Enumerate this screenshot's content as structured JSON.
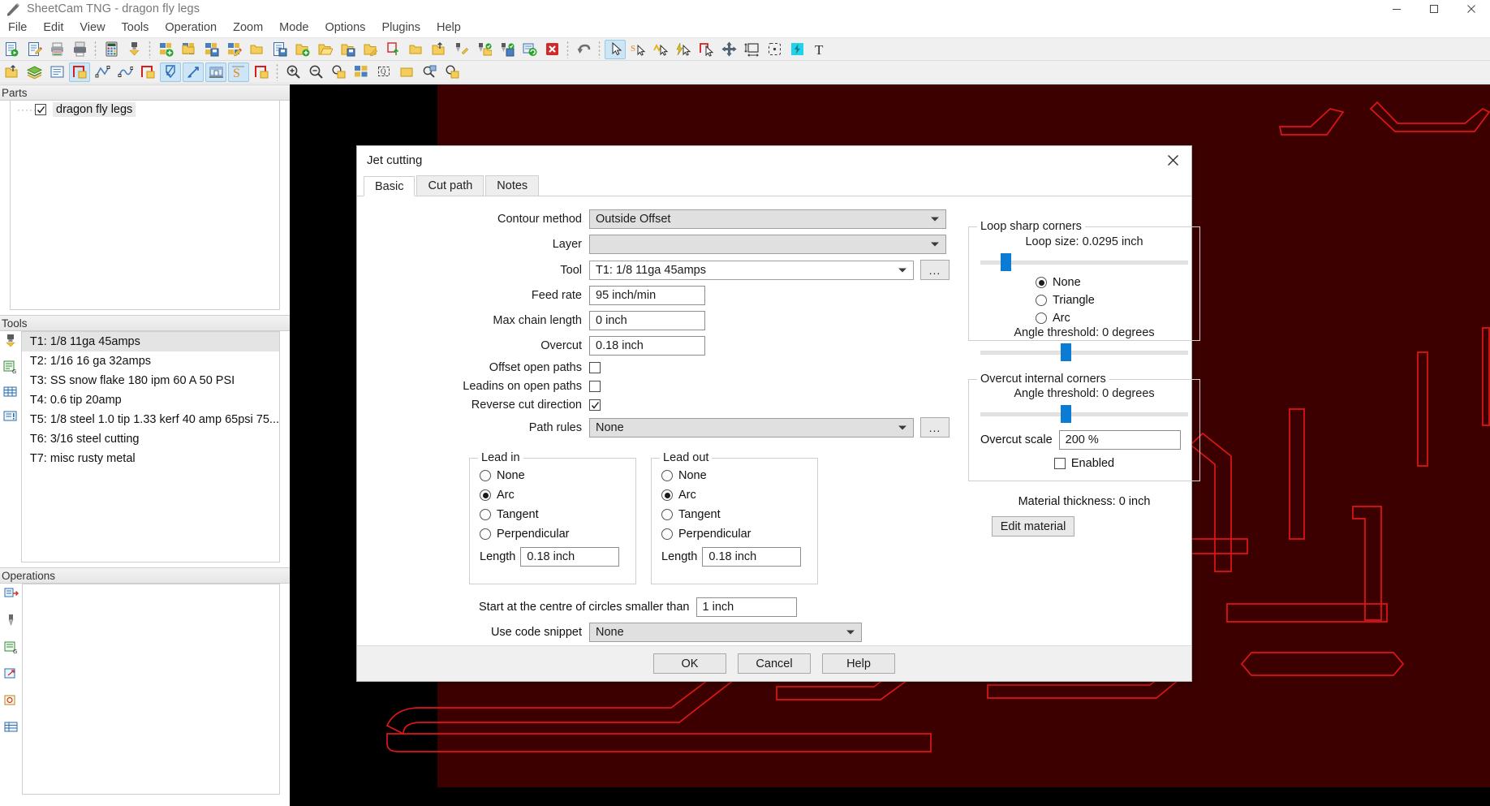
{
  "window": {
    "title": "SheetCam TNG - dragon fly legs",
    "controls": {
      "minimize": "minimize-button",
      "maximize": "maximize-button",
      "close": "close-button"
    }
  },
  "menu": [
    "File",
    "Edit",
    "View",
    "Tools",
    "Operation",
    "Zoom",
    "Mode",
    "Options",
    "Plugins",
    "Help"
  ],
  "toolbar_row1": [
    "run-post-processor-icon",
    "edit-document-icon",
    "print-icon",
    "printer-setup-icon",
    "sep",
    "calculator-icon",
    "tool-library-icon",
    "sep",
    "new-job-icon",
    "open-job-icon",
    "save-job-icon",
    "edit-job-icon",
    "open-folder-icon",
    "save-copy-icon",
    "add-part-icon",
    "open-part-icon",
    "save-part-icon",
    "edit-part-icon",
    "import-part-icon",
    "part-folder-icon",
    "export-icon",
    "tool-new-icon",
    "tool-open-icon",
    "tool-save-icon",
    "refresh-icon",
    "delete-icon",
    "sep",
    "undo-icon",
    "sep",
    "select-pointer-icon",
    "snap-pointer-icon",
    "node-pointer-icon",
    "fast-pointer-icon",
    "shape-pointer-icon",
    "move-icon",
    "measure-icon",
    "bounding-box-icon",
    "plasma-icon",
    "text-icon"
  ],
  "toolbar_row2": [
    "export-table-icon",
    "layers-icon",
    "notes-icon",
    "rectangle-tool-icon",
    "polyline-tool-icon",
    "spline-tool-icon",
    "outline-tool-icon",
    "jet-cutting-icon",
    "leadin-tool-icon",
    "machine-setup-icon",
    "snippet-icon",
    "contour-icon",
    "sep",
    "zoom-in-icon",
    "zoom-out-icon",
    "zoom-fit-icon",
    "zoom-selection-icon",
    "zoom-window-icon",
    "zoom-previous-icon",
    "zoom-extents-icon",
    "zoom-part-icon"
  ],
  "panels": {
    "parts": {
      "header": "Parts",
      "items": [
        {
          "label": "dragon fly legs",
          "checked": true
        }
      ]
    },
    "tools": {
      "header": "Tools",
      "items": [
        "T1: 1/8 11ga 45amps",
        "T2: 1/16 16 ga 32amps",
        "T3: SS snow flake 180 ipm 60 A 50 PSI",
        "T4: 0.6 tip 20amp",
        "T5: 1/8 steel 1.0 tip 1.33 kerf 40 amp 65psi 75...",
        "T6: 3/16 steel cutting",
        "T7: misc rusty metal"
      ],
      "selected_index": 0,
      "side_icons": [
        "tool-icon",
        "gcode-icon",
        "table-icon",
        "info-icon"
      ]
    },
    "operations": {
      "header": "Operations",
      "items": [],
      "side_icons": [
        "jet-cut-icon",
        "drill-icon",
        "gcode-op-icon",
        "move-op-icon",
        "marker-op-icon",
        "table-op-icon"
      ]
    }
  },
  "dialog": {
    "title": "Jet cutting",
    "close_label": "✕",
    "tabs": [
      {
        "label": "Basic",
        "active": true
      },
      {
        "label": "Cut path",
        "active": false
      },
      {
        "label": "Notes",
        "active": false
      }
    ],
    "fields": {
      "contour_method": {
        "label": "Contour method",
        "value": "Outside Offset"
      },
      "layer": {
        "label": "Layer",
        "value": ""
      },
      "tool": {
        "label": "Tool",
        "value": "T1: 1/8 11ga 45amps",
        "browse": "..."
      },
      "feed_rate": {
        "label": "Feed rate",
        "value": "95 inch/min"
      },
      "max_chain_length": {
        "label": "Max chain length",
        "value": "0 inch"
      },
      "overcut": {
        "label": "Overcut",
        "value": "0.18 inch"
      },
      "offset_open_paths": {
        "label": "Offset open paths",
        "checked": false
      },
      "leadins_on_open_paths": {
        "label": "Leadins on open paths",
        "checked": false
      },
      "reverse_cut_direction": {
        "label": "Reverse cut direction",
        "checked": true
      },
      "path_rules": {
        "label": "Path rules",
        "value": "None",
        "browse": "..."
      },
      "start_centre": {
        "label": "Start at the centre of circles smaller than",
        "value": "1 inch"
      },
      "code_snippet": {
        "label": "Use code snippet",
        "value": "None"
      }
    },
    "lead_in": {
      "title": "Lead in",
      "options": [
        "None",
        "Arc",
        "Tangent",
        "Perpendicular"
      ],
      "selected": "Arc",
      "length_label": "Length",
      "length_value": "0.18 inch"
    },
    "lead_out": {
      "title": "Lead out",
      "options": [
        "None",
        "Arc",
        "Tangent",
        "Perpendicular"
      ],
      "selected": "Arc",
      "length_label": "Length",
      "length_value": "0.18 inch"
    },
    "loop_sharp_corners": {
      "title": "Loop sharp corners",
      "loop_size_label": "Loop size: 0.0295 inch",
      "loop_size_percent": 12,
      "options": [
        "None",
        "Triangle",
        "Arc"
      ],
      "selected": "None",
      "angle_threshold_label": "Angle threshold: 0 degrees",
      "angle_threshold_percent": 41
    },
    "overcut_internal_corners": {
      "title": "Overcut internal corners",
      "angle_threshold_label": "Angle threshold: 0 degrees",
      "angle_threshold_percent": 41,
      "overcut_scale_label": "Overcut scale",
      "overcut_scale_value": "200 %",
      "enabled_label": "Enabled",
      "enabled": false
    },
    "material": {
      "thickness_label": "Material thickness: 0 inch",
      "edit_button": "Edit material"
    },
    "buttons": {
      "ok": "OK",
      "cancel": "Cancel",
      "help": "Help"
    }
  },
  "colors": {
    "accent": "#0a7cd4",
    "drawing_stroke": "#e01616",
    "material_bg": "#3d0000",
    "canvas_bg": "#000000"
  }
}
